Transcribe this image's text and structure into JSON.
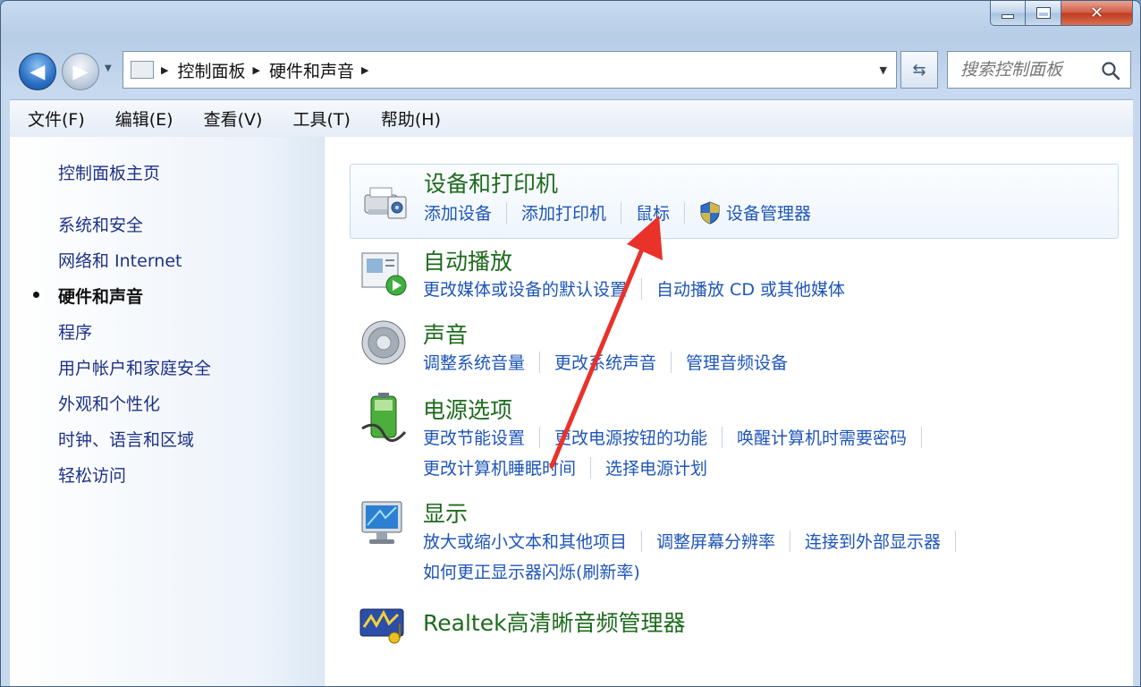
{
  "window": {
    "close_glyph": "✕"
  },
  "nav": {
    "back_glyph": "◀",
    "forward_glyph": "▶",
    "history_dropdown_glyph": "▼",
    "address": {
      "root_icon": "control-panel-icon",
      "separator_glyph": "▶",
      "crumbs": [
        "控制面板",
        "硬件和声音"
      ],
      "dropdown_glyph": "▼"
    },
    "refresh_glyph": "⇆",
    "search_placeholder": "搜索控制面板"
  },
  "menu": {
    "items": [
      "文件(F)",
      "编辑(E)",
      "查看(V)",
      "工具(T)",
      "帮助(H)"
    ]
  },
  "sidebar": {
    "home": "控制面板主页",
    "items": [
      {
        "label": "系统和安全"
      },
      {
        "label": "网络和 Internet"
      },
      {
        "label": "硬件和声音",
        "current": true
      },
      {
        "label": "程序"
      },
      {
        "label": "用户帐户和家庭安全"
      },
      {
        "label": "外观和个性化"
      },
      {
        "label": "时钟、语言和区域"
      },
      {
        "label": "轻松访问"
      }
    ]
  },
  "categories": [
    {
      "title": "设备和打印机",
      "icon": "printer-icon",
      "links": [
        [
          "添加设备",
          "添加打印机",
          "鼠标",
          "设备管理器"
        ]
      ]
    },
    {
      "title": "自动播放",
      "icon": "autoplay-icon",
      "links": [
        [
          "更改媒体或设备的默认设置",
          "自动播放 CD 或其他媒体"
        ]
      ]
    },
    {
      "title": "声音",
      "icon": "speaker-icon",
      "links": [
        [
          "调整系统音量",
          "更改系统声音",
          "管理音频设备"
        ]
      ]
    },
    {
      "title": "电源选项",
      "icon": "battery-icon",
      "links": [
        [
          "更改节能设置",
          "更改电源按钮的功能",
          "唤醒计算机时需要密码"
        ],
        [
          "更改计算机睡眠时间",
          "选择电源计划"
        ]
      ]
    },
    {
      "title": "显示",
      "icon": "monitor-icon",
      "links": [
        [
          "放大或缩小文本和其他项目",
          "调整屏幕分辨率",
          "连接到外部显示器"
        ],
        [
          "如何更正显示器闪烁(刷新率)"
        ]
      ]
    },
    {
      "title": "Realtek高清晰音频管理器",
      "icon": "realtek-audio-icon",
      "links": []
    }
  ],
  "colors": {
    "link": "#1e55b8",
    "category_title": "#1e6b1e",
    "annotation_arrow": "#e8322a"
  }
}
